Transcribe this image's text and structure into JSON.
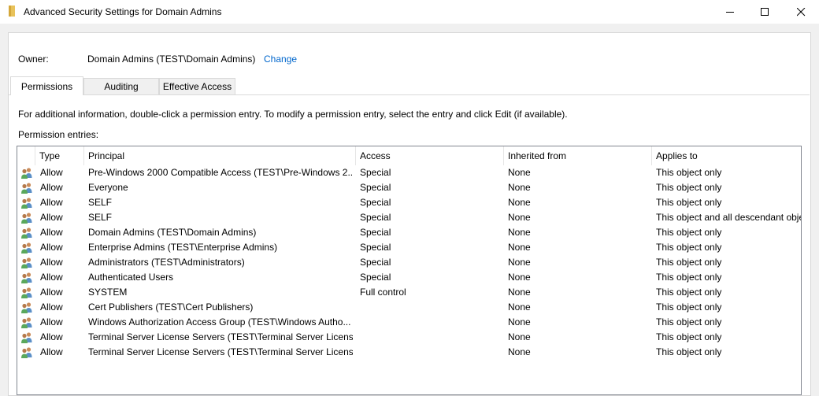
{
  "window": {
    "title": "Advanced Security Settings for Domain Admins"
  },
  "owner": {
    "label": "Owner:",
    "value": "Domain Admins (TEST\\Domain Admins)",
    "change_label": "Change"
  },
  "tabs": [
    {
      "label": "Permissions",
      "active": true
    },
    {
      "label": "Auditing",
      "active": false
    },
    {
      "label": "Effective Access",
      "active": false
    }
  ],
  "info_text": "For additional information, double-click a permission entry. To modify a permission entry, select the entry and click Edit (if available).",
  "entries_label": "Permission entries:",
  "columns": [
    "Type",
    "Principal",
    "Access",
    "Inherited from",
    "Applies to"
  ],
  "rows": [
    {
      "type": "Allow",
      "principal": "Pre-Windows 2000 Compatible Access (TEST\\Pre-Windows 2...",
      "access": "Special",
      "inherited": "None",
      "applies": "This object only"
    },
    {
      "type": "Allow",
      "principal": "Everyone",
      "access": "Special",
      "inherited": "None",
      "applies": "This object only"
    },
    {
      "type": "Allow",
      "principal": "SELF",
      "access": "Special",
      "inherited": "None",
      "applies": "This object only"
    },
    {
      "type": "Allow",
      "principal": "SELF",
      "access": "Special",
      "inherited": "None",
      "applies": "This object and all descendant obje"
    },
    {
      "type": "Allow",
      "principal": "Domain Admins (TEST\\Domain Admins)",
      "access": "Special",
      "inherited": "None",
      "applies": "This object only"
    },
    {
      "type": "Allow",
      "principal": "Enterprise Admins (TEST\\Enterprise Admins)",
      "access": "Special",
      "inherited": "None",
      "applies": "This object only"
    },
    {
      "type": "Allow",
      "principal": "Administrators (TEST\\Administrators)",
      "access": "Special",
      "inherited": "None",
      "applies": "This object only"
    },
    {
      "type": "Allow",
      "principal": "Authenticated Users",
      "access": "Special",
      "inherited": "None",
      "applies": "This object only"
    },
    {
      "type": "Allow",
      "principal": "SYSTEM",
      "access": "Full control",
      "inherited": "None",
      "applies": "This object only"
    },
    {
      "type": "Allow",
      "principal": "Cert Publishers (TEST\\Cert Publishers)",
      "access": "",
      "inherited": "None",
      "applies": "This object only"
    },
    {
      "type": "Allow",
      "principal": "Windows Authorization Access Group (TEST\\Windows Autho...",
      "access": "",
      "inherited": "None",
      "applies": "This object only"
    },
    {
      "type": "Allow",
      "principal": "Terminal Server License Servers (TEST\\Terminal Server License...",
      "access": "",
      "inherited": "None",
      "applies": "This object only"
    },
    {
      "type": "Allow",
      "principal": "Terminal Server License Servers (TEST\\Terminal Server License...",
      "access": "",
      "inherited": "None",
      "applies": "This object only"
    }
  ],
  "icons": {
    "title": "folder-icon",
    "row": "users-icon"
  },
  "colors": {
    "link": "#0066cc",
    "folder": "#e8c25a"
  }
}
